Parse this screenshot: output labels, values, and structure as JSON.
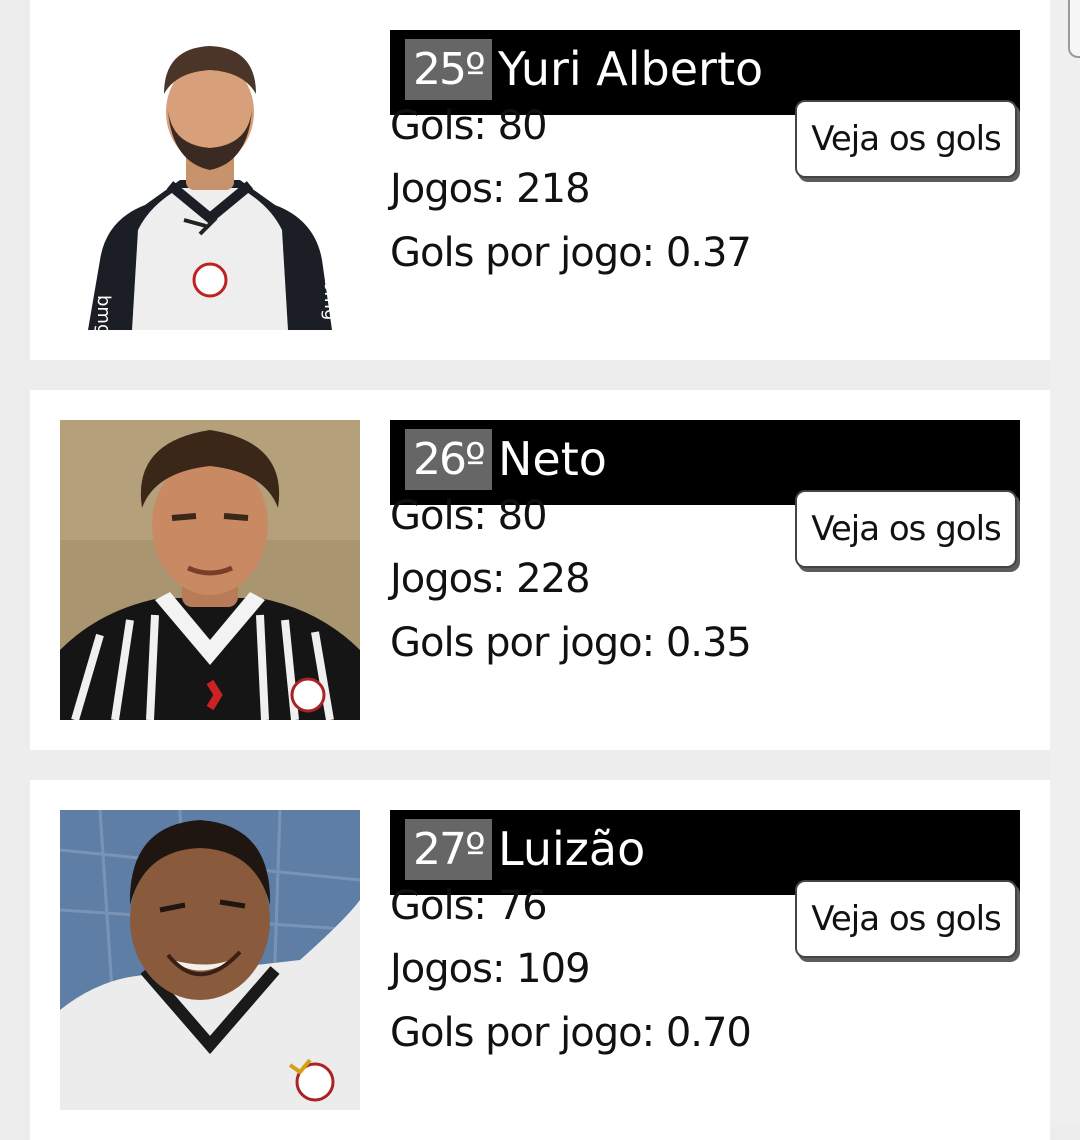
{
  "players": [
    {
      "rank": "25º",
      "name": "Yuri Alberto",
      "goals_label": "Gols: ",
      "goals": "80",
      "games_label": "Jogos: ",
      "games": "218",
      "ratio_label": "Gols por jogo: ",
      "ratio": "0.37",
      "button_label": "Veja os gols"
    },
    {
      "rank": "26º",
      "name": "Neto",
      "goals_label": "Gols: ",
      "goals": "80",
      "games_label": "Jogos: ",
      "games": "228",
      "ratio_label": "Gols por jogo: ",
      "ratio": "0.35",
      "button_label": "Veja os gols"
    },
    {
      "rank": "27º",
      "name": "Luizão",
      "goals_label": "Gols: ",
      "goals": "76",
      "games_label": "Jogos: ",
      "games": "109",
      "ratio_label": "Gols por jogo: ",
      "ratio": "0.70",
      "button_label": "Veja os gols"
    }
  ],
  "colors": {
    "page_background": "#ededed",
    "card_background": "#ffffff",
    "banner_background": "#000000",
    "rank_background": "#666666",
    "text": "#111111"
  }
}
